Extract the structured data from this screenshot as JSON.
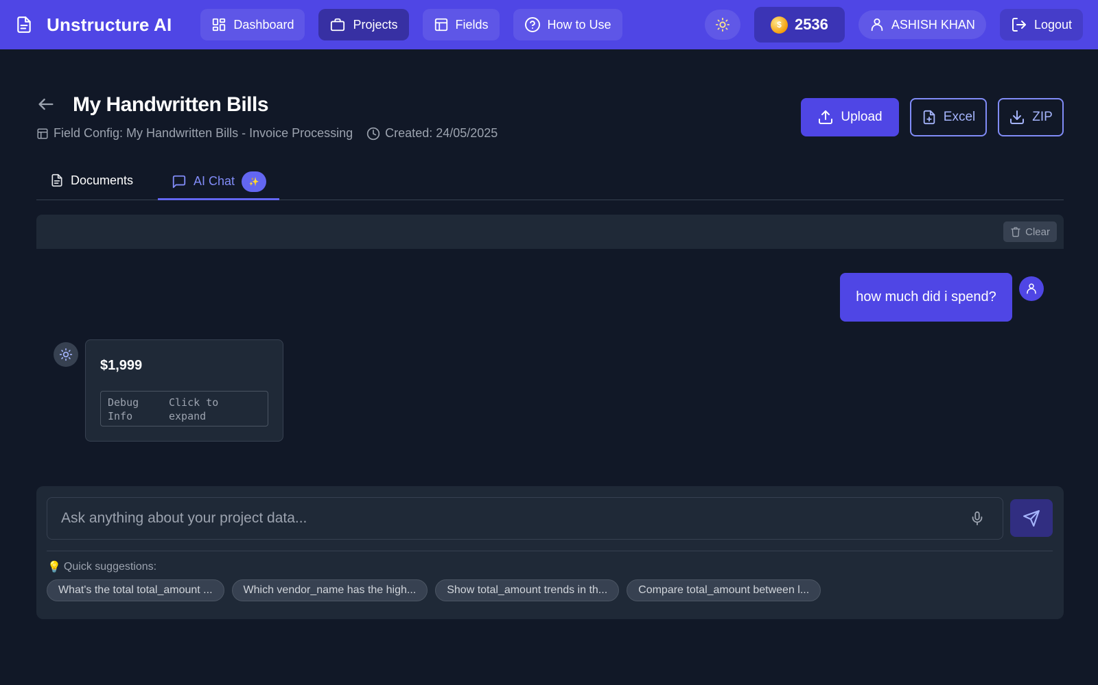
{
  "app": {
    "title": "Unstructure AI"
  },
  "nav": [
    {
      "label": "Dashboard",
      "icon": "dashboard-icon",
      "active": false
    },
    {
      "label": "Projects",
      "icon": "briefcase-icon",
      "active": true
    },
    {
      "label": "Fields",
      "icon": "table-icon",
      "active": false
    },
    {
      "label": "How to Use",
      "icon": "help-icon",
      "active": false
    }
  ],
  "toolbar": {
    "coin_balance": "2536",
    "coin_symbol": "$",
    "user_name": "ASHISH KHAN",
    "logout_label": "Logout"
  },
  "project": {
    "title": "My Handwritten Bills",
    "field_config": "Field Config: My Handwritten Bills - Invoice Processing",
    "created": "Created: 24/05/2025",
    "upload_label": "Upload",
    "excel_label": "Excel",
    "zip_label": "ZIP"
  },
  "tabs": {
    "documents": "Documents",
    "ai_chat": "AI Chat",
    "ai_chat_badge": "✨"
  },
  "chat": {
    "clear_label": "Clear",
    "messages": [
      {
        "role": "user",
        "text": "how much did i spend?"
      },
      {
        "role": "assistant",
        "text": "$1,999",
        "debug_label": "Debug Info",
        "debug_hint": "Click to expand"
      }
    ],
    "input_placeholder": "Ask anything about your project data...",
    "input_value": "",
    "suggestions_label": "Quick suggestions:",
    "suggestions_emoji": "💡",
    "suggestions": [
      "What's the total total_amount ...",
      "Which vendor_name has the high...",
      "Show total_amount trends in th...",
      "Compare total_amount between l..."
    ]
  },
  "colors": {
    "brand": "#4f46e5",
    "background": "#111827",
    "panel": "#1f2937",
    "accent_text": "#818cf8"
  }
}
